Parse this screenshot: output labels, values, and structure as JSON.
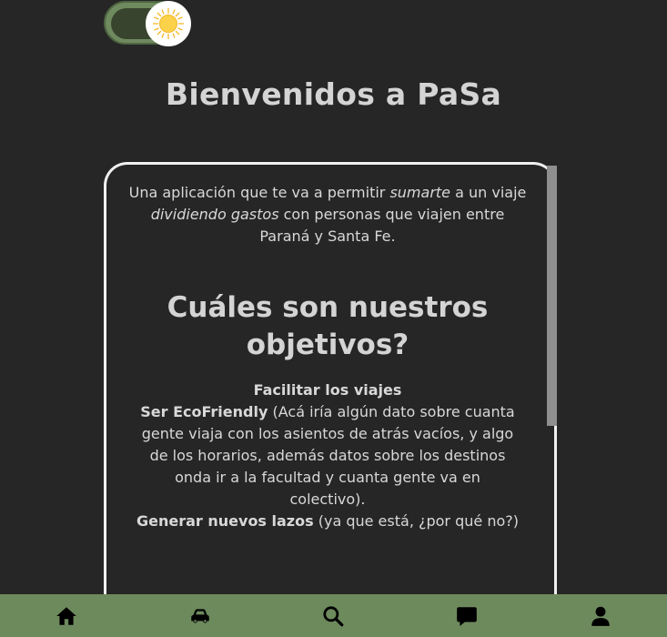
{
  "theme_toggle": {
    "icon": "sun-icon",
    "state": "light"
  },
  "page_title": "Bienvenidos a PaSa",
  "intro": {
    "part1": "Una aplicación que te va a permitir ",
    "emph1": "sumarte",
    "part2": " a un viaje ",
    "emph2": "dividiendo gastos",
    "part3": " con personas que viajen entre Paraná y Santa Fe."
  },
  "section_title": "Cuáles son nuestros objetivos?",
  "objectives": {
    "item1_title": "Facilitar los viajes",
    "item2_title": "Ser EcoFriendly",
    "item2_text": " (Acá iría algún dato sobre cuanta gente viaja con los asientos de atrás vacíos, y algo de los horarios, además datos sobre los destinos onda ir a la facultad y cuanta gente va en colectivo).",
    "item3_title": "Generar nuevos lazos",
    "item3_text": " (ya que está, ¿por qué no?)"
  },
  "bottom_nav": [
    {
      "icon": "home-icon"
    },
    {
      "icon": "car-icon"
    },
    {
      "icon": "search-icon"
    },
    {
      "icon": "chat-icon"
    },
    {
      "icon": "user-icon"
    }
  ],
  "colors": {
    "background": "#262626",
    "accent_green": "#6d8a5d",
    "text": "#d8d8d8",
    "card_border": "#f0f0f0"
  }
}
